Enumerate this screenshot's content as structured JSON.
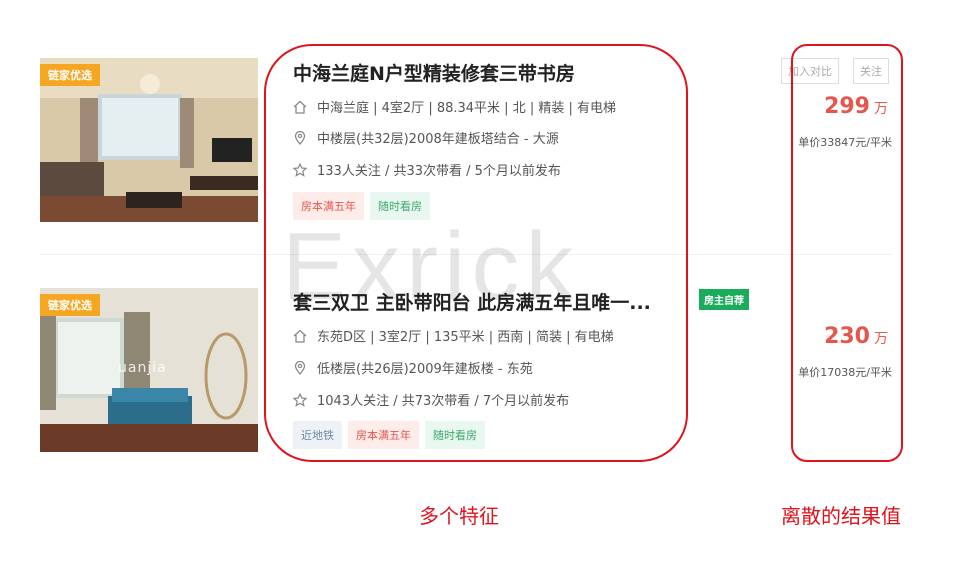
{
  "listings": [
    {
      "badge": "链家优选",
      "title": "中海兰庭N户型精装修套三带书房",
      "info": "中海兰庭 | 4室2厅 | 88.34平米 | 北 | 精装 | 有电梯",
      "floor": "中楼层(共32层)2008年建板塔结合 - 大源",
      "follow": "133人关注 / 共33次带看 / 5个月以前发布",
      "tags": [
        "房本满五年",
        "随时看房"
      ],
      "price": "299",
      "price_unit": "万",
      "unit_price": "单价33847元/平米",
      "compare_label": "加入对比",
      "follow_label": "关注"
    },
    {
      "badge": "链家优选",
      "photo_watermark": "uanjia",
      "title": "套三双卫 主卧带阳台 此房满五年且唯一...",
      "owner_badge": "房主自荐",
      "info": "东苑D区 | 3室2厅 | 135平米 | 西南 | 简装 | 有电梯",
      "floor": "低楼层(共26层)2009年建板楼 - 东苑",
      "follow": "1043人关注 / 共73次带看 / 7个月以前发布",
      "tags": [
        "近地铁",
        "房本满五年",
        "随时看房"
      ],
      "price": "230",
      "price_unit": "万",
      "unit_price": "单价17038元/平米"
    }
  ],
  "watermark": "Exrick",
  "annotations": {
    "features_label": "多个特征",
    "result_label": "离散的结果值"
  },
  "colors": {
    "accent_red": "#e4574c",
    "annotation_red": "#e0131d",
    "badge_orange": "#f5a623",
    "owner_green": "#1aab5c"
  }
}
